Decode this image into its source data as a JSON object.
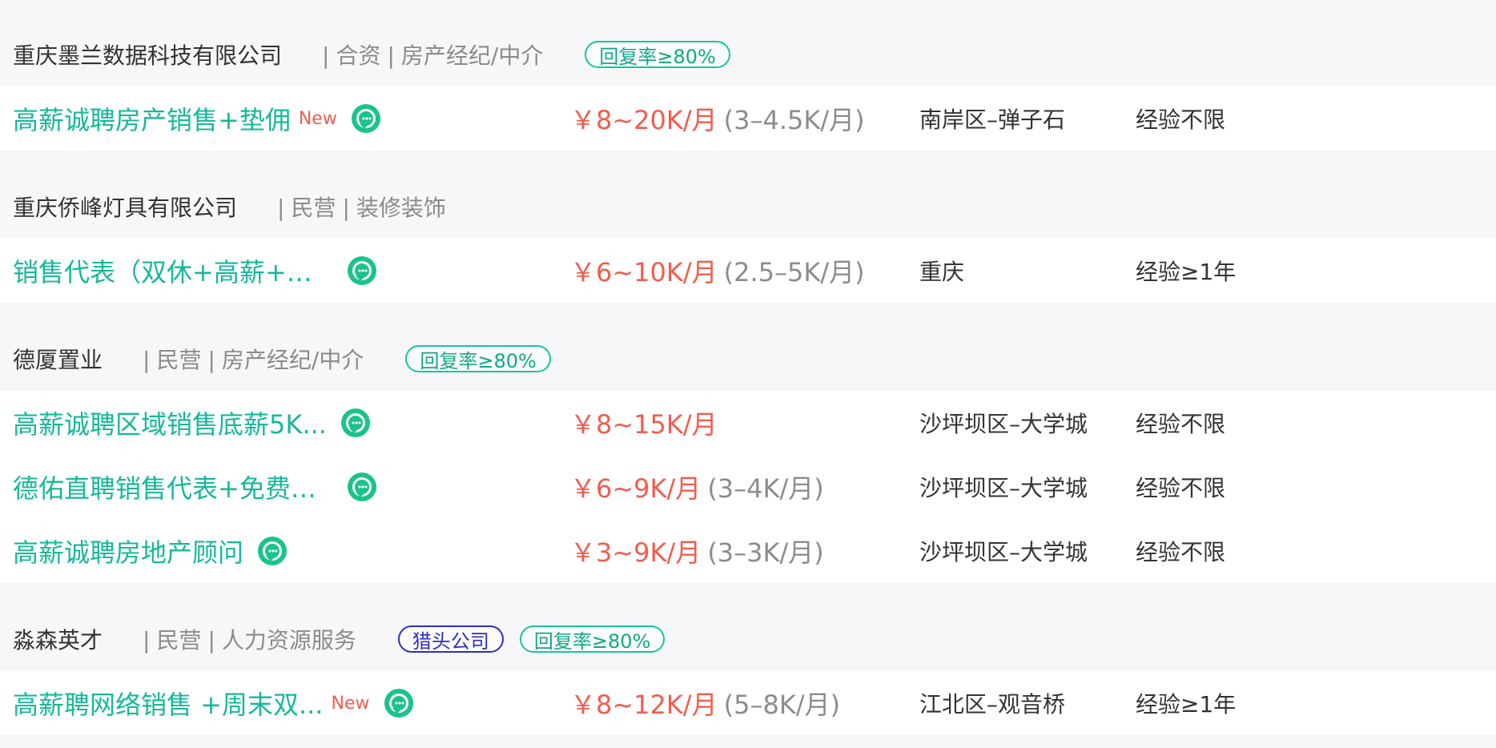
{
  "companies": [
    {
      "name": "重庆墨兰数据科技有限公司",
      "meta_1": "合资",
      "meta_2": "房产经纪/中介",
      "badges": [
        "回复率≥80%"
      ],
      "jobs": [
        {
          "title": "高薪诚聘房产销售+垫佣",
          "new_label": "New",
          "salary": "￥8~20K/月",
          "salary_note": "(3–4.5K/月)",
          "location": "南岸区–弹子石",
          "experience": "经验不限"
        }
      ]
    },
    {
      "name": "重庆侨峰灯具有限公司",
      "meta_1": "民营",
      "meta_2": "装修装饰",
      "badges": [],
      "jobs": [
        {
          "title": "销售代表（双休+高薪+公...",
          "new_label": "",
          "salary": "￥6~10K/月",
          "salary_note": "(2.5–5K/月)",
          "location": "重庆",
          "experience": "经验≥1年"
        }
      ]
    },
    {
      "name": "德厦置业",
      "meta_1": "民营",
      "meta_2": "房产经纪/中介",
      "badges": [
        "回复率≥80%"
      ],
      "jobs": [
        {
          "title": "高薪诚聘区域销售底薪5K...",
          "new_label": "",
          "salary": "￥8~15K/月",
          "salary_note": "",
          "location": "沙坪坝区–大学城",
          "experience": "经验不限"
        },
        {
          "title": "德佑直聘销售代表+免费端...",
          "new_label": "",
          "salary": "￥6~9K/月",
          "salary_note": "(3–4K/月)",
          "location": "沙坪坝区–大学城",
          "experience": "经验不限"
        },
        {
          "title": "高薪诚聘房地产顾问",
          "new_label": "",
          "salary": "￥3~9K/月",
          "salary_note": "(3–3K/月)",
          "location": "沙坪坝区–大学城",
          "experience": "经验不限"
        }
      ]
    },
    {
      "name": "淼森英才",
      "meta_1": "民营",
      "meta_2": "人力资源服务",
      "badges": [
        "猎头公司",
        "回复率≥80%"
      ],
      "jobs": [
        {
          "title": "高薪聘网络销售 +周末双...",
          "new_label": "New",
          "salary": "￥8~12K/月",
          "salary_note": "(5–8K/月)",
          "location": "江北区–观音桥",
          "experience": "经验≥1年"
        }
      ]
    }
  ],
  "colors": {
    "title": "#16b899",
    "salary": "#f15d4d",
    "reply_badge": "#16c5a2",
    "headhunter_badge": "#2c2fbf",
    "chat_icon": "#1ac38a"
  },
  "icons": {
    "chat": "chat-bubble-icon"
  }
}
